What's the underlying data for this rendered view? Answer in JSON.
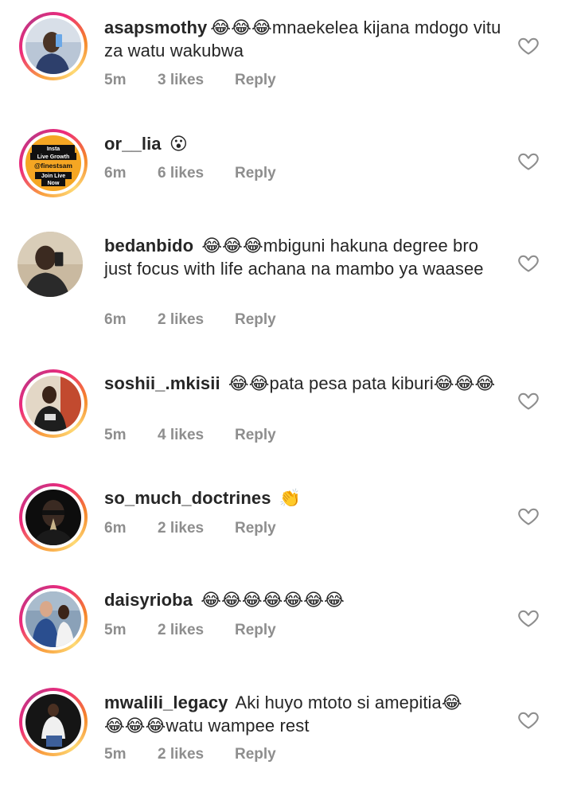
{
  "comments": [
    {
      "username": "asapsmothy",
      "emoji_prefix": "😂😂😂",
      "text": "mnaekelea kijana mdogo vitu za watu wakubwa",
      "emoji_suffix": "",
      "time": "5m",
      "likes": "3 likes",
      "reply": "Reply",
      "avatar": "person-selfie"
    },
    {
      "username": "or__lia",
      "emoji_prefix": "😮",
      "text": "",
      "emoji_suffix": "",
      "time": "6m",
      "likes": "6 likes",
      "reply": "Reply",
      "avatar": "promo-badge"
    },
    {
      "username": "bedanbido",
      "emoji_prefix": "😂😂😂",
      "text": "mbiguni hakuna degree bro just focus with life achana na mambo ya waasee",
      "emoji_suffix": "",
      "time": "6m",
      "likes": "2 likes",
      "reply": "Reply",
      "avatar": "person-selfie"
    },
    {
      "username": "soshii_.mkisii",
      "emoji_prefix": "😂😂",
      "text": "pata pesa pata kiburi",
      "emoji_suffix": "😂😂😂",
      "time": "5m",
      "likes": "4 likes",
      "reply": "Reply",
      "avatar": "person-standing"
    },
    {
      "username": "so_much_doctrines",
      "emoji_prefix": "👏",
      "text": "",
      "emoji_suffix": "",
      "time": "6m",
      "likes": "2 likes",
      "reply": "Reply",
      "avatar": "person-dark"
    },
    {
      "username": "daisyrioba",
      "emoji_prefix": "😂😂😂😂😂😂😂",
      "text": "",
      "emoji_suffix": "",
      "time": "5m",
      "likes": "2 likes",
      "reply": "Reply",
      "avatar": "couple"
    },
    {
      "username": "mwalili_legacy",
      "emoji_prefix": "",
      "text": "Aki huyo mtoto si amepitia",
      "emoji_suffix": "😂",
      "text2_emoji": "😂😂😂",
      "text2": "watu wampee rest",
      "time": "5m",
      "likes": "2 likes",
      "reply": "Reply",
      "avatar": "person-sitting"
    }
  ],
  "avatar_promo": {
    "line1": "Insta",
    "line2": "Live Growth",
    "line3": "@finestsam",
    "line4": "Join Live",
    "line5": "Now"
  },
  "colors": {
    "text": "#262626",
    "meta": "#8e8e8e",
    "ring_start": "#f58529",
    "ring_mid": "#dd2a7b",
    "promo_bg": "#f5a623"
  }
}
